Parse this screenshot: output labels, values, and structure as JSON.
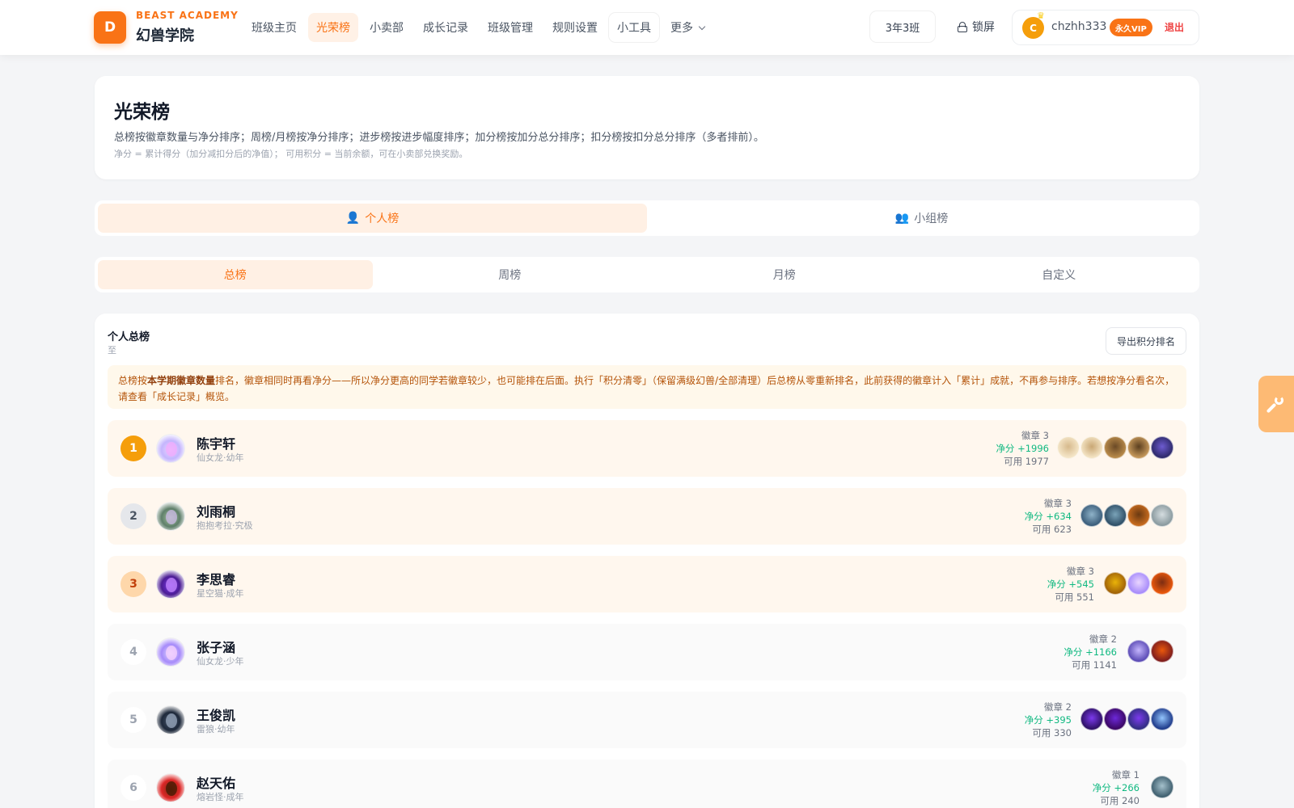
{
  "brand": {
    "logo_letter": "D",
    "name_en": "BEAST ACADEMY",
    "name_cn": "幻兽学院"
  },
  "nav": {
    "items": [
      {
        "label": "班级主页"
      },
      {
        "label": "光荣榜",
        "active": true
      },
      {
        "label": "小卖部"
      },
      {
        "label": "成长记录"
      },
      {
        "label": "班级管理"
      },
      {
        "label": "规则设置"
      },
      {
        "label": "小工具"
      }
    ],
    "more_label": "更多"
  },
  "header": {
    "class_name": "3年3班",
    "lock_label": "锁屏",
    "user": {
      "avatar_letter": "C",
      "name": "chzhh333",
      "vip_label": "永久VIP",
      "logout_label": "退出"
    }
  },
  "page": {
    "title": "光荣榜",
    "desc_main": "总榜按徽章数量与净分排序；周榜/月榜按净分排序；进步榜按进步幅度排序；加分榜按加分总分排序；扣分榜按扣分总分排序（多者排前）。",
    "desc_sub": "净分 = 累计得分（加分减扣分后的净值）； 可用积分 = 当前余额，可在小卖部兑换奖励。"
  },
  "scope_tabs": [
    {
      "icon": "👤",
      "label": "个人榜",
      "active": true
    },
    {
      "icon": "👥",
      "label": "小组榜",
      "active": false
    }
  ],
  "period_tabs": [
    {
      "label": "总榜",
      "active": true
    },
    {
      "label": "周榜"
    },
    {
      "label": "月榜"
    },
    {
      "label": "自定义"
    }
  ],
  "ranking": {
    "title": "个人总榜",
    "range_text": "至",
    "export_label": "导出积分排名",
    "notice_prefix": "总榜按",
    "notice_bold": "本学期徽章数量",
    "notice_suffix": "排名，徽章相同时再看净分——所以净分更高的同学若徽章较少，也可能排在后面。执行「积分清零」（保留满级幻兽/全部清理）后总榜从零重新排名，此前获得的徽章计入「累计」成就，不再参与排序。若想按净分看名次，请查看「成长记录」概览。",
    "rows": [
      {
        "rank": "1",
        "name": "陈宇轩",
        "pet": "仙女龙·幼年",
        "badges_text": "徽章 3",
        "net_text": "净分 +1996",
        "avail_text": "可用 1977",
        "avatar_colors": [
          "#e9d5ff",
          "#c4b5fd",
          "#f0abfc"
        ],
        "badge_colors": [
          [
            "#f5e6c8",
            "#d6b98c"
          ],
          [
            "#f3e3c3",
            "#c9a774"
          ],
          [
            "#b88a4a",
            "#6b4a26"
          ],
          [
            "#c4975a",
            "#5b3f1f"
          ],
          [
            "#2e2a6b",
            "#6d5bd0"
          ]
        ]
      },
      {
        "rank": "2",
        "name": "刘雨桐",
        "pet": "抱抱考拉·究极",
        "badges_text": "徽章 3",
        "net_text": "净分 +634",
        "avail_text": "可用 623",
        "avatar_colors": [
          "#a7c4a0",
          "#5f7f6a",
          "#c7b8e0"
        ],
        "badge_colors": [
          [
            "#3b5d7a",
            "#8fb3c9"
          ],
          [
            "#2f4f67",
            "#7aa3b8"
          ],
          [
            "#c76b1e",
            "#6b3a12"
          ],
          [
            "#8a9a9f",
            "#d5dde0"
          ]
        ]
      },
      {
        "rank": "3",
        "name": "李思睿",
        "pet": "星空猫·成年",
        "badges_text": "徽章 3",
        "net_text": "净分 +545",
        "avail_text": "可用 551",
        "avatar_colors": [
          "#7c3aed",
          "#4c1d95",
          "#c084fc"
        ],
        "badge_colors": [
          [
            "#a16207",
            "#eab308"
          ],
          [
            "#a78bfa",
            "#e9d5ff"
          ],
          [
            "#ea580c",
            "#7c2d12"
          ]
        ]
      },
      {
        "rank": "4",
        "name": "张子涵",
        "pet": "仙女龙·少年",
        "badges_text": "徽章 2",
        "net_text": "净分 +1166",
        "avail_text": "可用 1141",
        "avatar_colors": [
          "#ddd6fe",
          "#a78bfa",
          "#f5d0fe"
        ],
        "badge_colors": [
          [
            "#5b4bb5",
            "#c4b5fd"
          ],
          [
            "#7f1d1d",
            "#ea580c"
          ]
        ]
      },
      {
        "rank": "5",
        "name": "王俊凯",
        "pet": "雷狼·幼年",
        "badges_text": "徽章 2",
        "net_text": "净分 +395",
        "avail_text": "可用 330",
        "avatar_colors": [
          "#475569",
          "#1e293b",
          "#94a3b8"
        ],
        "badge_colors": [
          [
            "#2e1065",
            "#7c3aed"
          ],
          [
            "#3b0764",
            "#6d28d9"
          ],
          [
            "#312e81",
            "#7c3aed"
          ],
          [
            "#1e3a8a",
            "#93c5fd"
          ]
        ]
      },
      {
        "rank": "6",
        "name": "赵天佑",
        "pet": "熔岩怪·成年",
        "badges_text": "徽章 1",
        "net_text": "净分 +266",
        "avail_text": "可用 240",
        "avatar_colors": [
          "#7c2d12",
          "#dc2626",
          "#451a03"
        ],
        "badge_colors": [
          [
            "#3f5f6f",
            "#a5c1cc"
          ]
        ]
      }
    ]
  },
  "colors": {
    "accent": "#f97316",
    "net_green": "#10b981",
    "logout_red": "#ef4444",
    "notice_text": "#b45309"
  }
}
